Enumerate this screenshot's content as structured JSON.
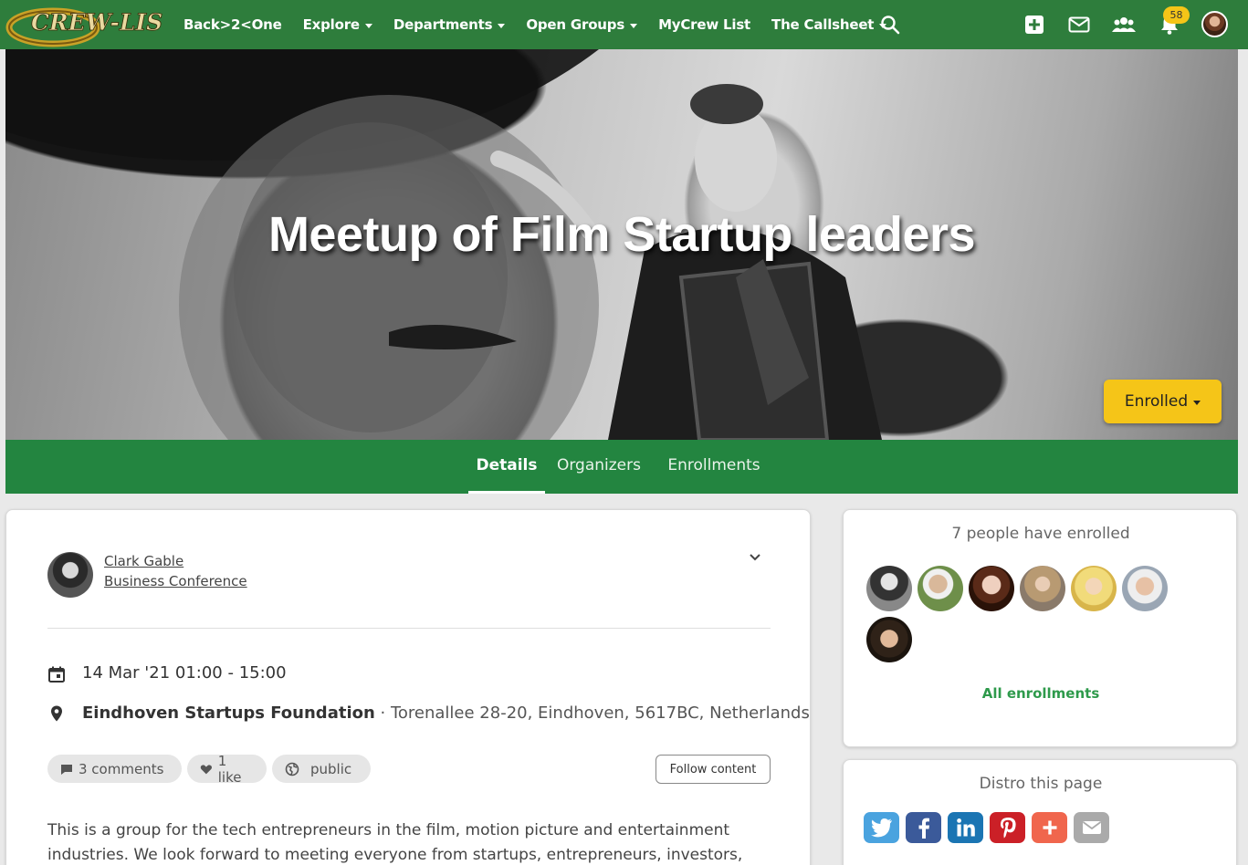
{
  "nav": {
    "logo_text": "CREW-LIST",
    "items": [
      {
        "label": "Back>2<One",
        "dropdown": false
      },
      {
        "label": "Explore",
        "dropdown": true
      },
      {
        "label": "Departments",
        "dropdown": true
      },
      {
        "label": "Open Groups",
        "dropdown": true
      },
      {
        "label": "MyCrew List",
        "dropdown": false
      },
      {
        "label": "The Callsheet",
        "dropdown": true
      }
    ],
    "notification_count": "58",
    "icons": [
      "search-icon",
      "add-icon",
      "mail-icon",
      "people-icon",
      "bell-icon",
      "user-avatar"
    ]
  },
  "hero": {
    "title": "Meetup of Film Startup leaders",
    "enrolled_label": "Enrolled"
  },
  "tabs": [
    "Details",
    "Organizers",
    "Enrollments"
  ],
  "active_tab": "Details",
  "post": {
    "author": "Clark Gable",
    "group": "Business Conference",
    "date": "14 Mar '21 01:00 - 15:00",
    "location_name": "Eindhoven Startups Foundation",
    "location_address": " · Torenallee 28-20, Eindhoven, 5617BC, Netherlands",
    "comments": "3 comments",
    "likes": "1 like",
    "visibility": "public",
    "follow_label": "Follow content",
    "description": "This is a group for the tech entrepreneurs in the film, motion picture and entertainment industries. We look forward to meeting everyone from startups, entrepreneurs, investors,"
  },
  "enrollments": {
    "title": "7 people have enrolled",
    "all_label": "All enrollments"
  },
  "distro": {
    "title": "Distro this page",
    "buttons": [
      "twitter-icon",
      "facebook-icon",
      "linkedin-icon",
      "pinterest-icon",
      "plus-icon",
      "email-icon"
    ]
  },
  "colors": {
    "nav_green": "#2e7d3c",
    "tab_green": "#238540",
    "accent_yellow": "#f5c518",
    "link_green": "#2e9a4b"
  }
}
